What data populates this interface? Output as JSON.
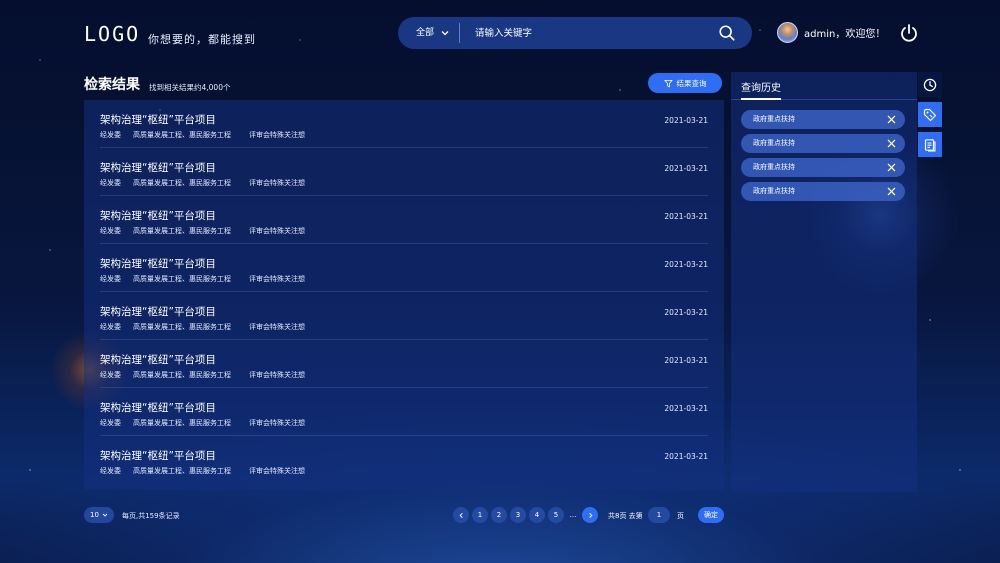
{
  "header": {
    "logo": "LOGO",
    "slogan": "你想要的，都能搜到",
    "search": {
      "scope_label": "全部",
      "placeholder": "请输入关键字"
    },
    "user": {
      "greeting": "admin，欢迎您！"
    }
  },
  "results": {
    "title": "检索结果",
    "count_text": "找到相关结果约4,000个",
    "filter_button": "结果查询",
    "items": [
      {
        "title": "架构治理“枢纽”平台项目",
        "tags": [
          "经发委",
          "高质量发展工程、惠民服务工程",
          "评审会特殊关注想"
        ],
        "date": "2021-03-21"
      },
      {
        "title": "架构治理“枢纽”平台项目",
        "tags": [
          "经发委",
          "高质量发展工程、惠民服务工程",
          "评审会特殊关注想"
        ],
        "date": "2021-03-21"
      },
      {
        "title": "架构治理“枢纽”平台项目",
        "tags": [
          "经发委",
          "高质量发展工程、惠民服务工程",
          "评审会特殊关注想"
        ],
        "date": "2021-03-21"
      },
      {
        "title": "架构治理“枢纽”平台项目",
        "tags": [
          "经发委",
          "高质量发展工程、惠民服务工程",
          "评审会特殊关注想"
        ],
        "date": "2021-03-21"
      },
      {
        "title": "架构治理“枢纽”平台项目",
        "tags": [
          "经发委",
          "高质量发展工程、惠民服务工程",
          "评审会特殊关注想"
        ],
        "date": "2021-03-21"
      },
      {
        "title": "架构治理“枢纽”平台项目",
        "tags": [
          "经发委",
          "高质量发展工程、惠民服务工程",
          "评审会特殊关注想"
        ],
        "date": "2021-03-21"
      },
      {
        "title": "架构治理“枢纽”平台项目",
        "tags": [
          "经发委",
          "高质量发展工程、惠民服务工程",
          "评审会特殊关注想"
        ],
        "date": "2021-03-21"
      },
      {
        "title": "架构治理“枢纽”平台项目",
        "tags": [
          "经发委",
          "高质量发展工程、惠民服务工程",
          "评审会特殊关注想"
        ],
        "date": "2021-03-21"
      }
    ]
  },
  "history": {
    "title": "查询历史",
    "items": [
      "政府重点扶持",
      "政府重点扶持",
      "政府重点扶持",
      "政府重点扶持"
    ]
  },
  "pagination": {
    "page_size": "10",
    "page_info": "每页,共159条记录",
    "pages": [
      "1",
      "2",
      "3",
      "4",
      "5"
    ],
    "ellipsis": "...",
    "goto_prefix": "共8页 去第",
    "goto_value": "1",
    "goto_suffix": "页",
    "confirm": "确定"
  },
  "colors": {
    "accent": "#2f6df2",
    "background": "#081740"
  }
}
